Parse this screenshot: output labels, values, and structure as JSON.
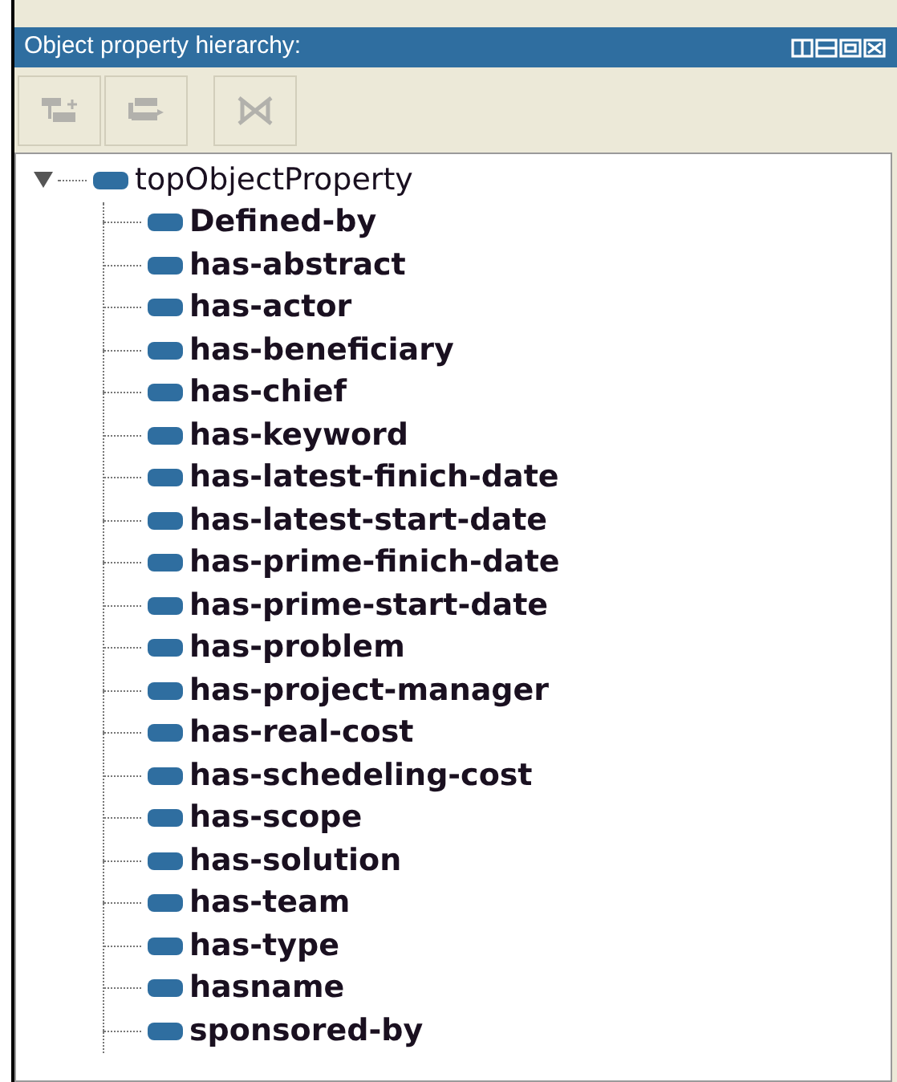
{
  "panel": {
    "title": "Object property hierarchy:"
  },
  "toolbar": [
    {
      "kind": "add-sub",
      "disabled": true
    },
    {
      "kind": "add-sibling",
      "disabled": true
    },
    {
      "kind": "delete",
      "disabled": true
    }
  ],
  "tree": [
    {
      "label": "topObjectProperty",
      "expanded": true,
      "children": [
        {
          "label": "Defined-by"
        },
        {
          "label": "has-abstract"
        },
        {
          "label": "has-actor"
        },
        {
          "label": "has-beneficiary"
        },
        {
          "label": "has-chief"
        },
        {
          "label": "has-keyword"
        },
        {
          "label": "has-latest-finich-date"
        },
        {
          "label": "has-latest-start-date"
        },
        {
          "label": "has-prime-finich-date"
        },
        {
          "label": "has-prime-start-date"
        },
        {
          "label": "has-problem"
        },
        {
          "label": "has-project-manager"
        },
        {
          "label": "has-real-cost"
        },
        {
          "label": "has-schedeling-cost"
        },
        {
          "label": "has-scope"
        },
        {
          "label": "has-solution"
        },
        {
          "label": "has-team"
        },
        {
          "label": "has-type"
        },
        {
          "label": "hasname"
        },
        {
          "label": "sponsored-by"
        }
      ]
    }
  ]
}
